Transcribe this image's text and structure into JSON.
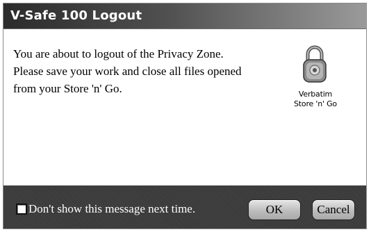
{
  "window": {
    "title": "V-Safe 100 Logout"
  },
  "message": {
    "line1": "You are about to logout of the Privacy Zone.",
    "line2": "Please save your work and close all files opened",
    "line3": "from your Store 'n' Go."
  },
  "brand": {
    "icon": "padlock-icon",
    "line1": "Verbatim",
    "line2": "Store 'n' Go"
  },
  "footer": {
    "checkbox_label": "Don't show this message next time.",
    "checkbox_checked": false,
    "ok_label": "OK",
    "cancel_label": "Cancel"
  },
  "colors": {
    "titlebar_dark": "#2b2b2b",
    "footer_bg": "#3a3a3a"
  }
}
